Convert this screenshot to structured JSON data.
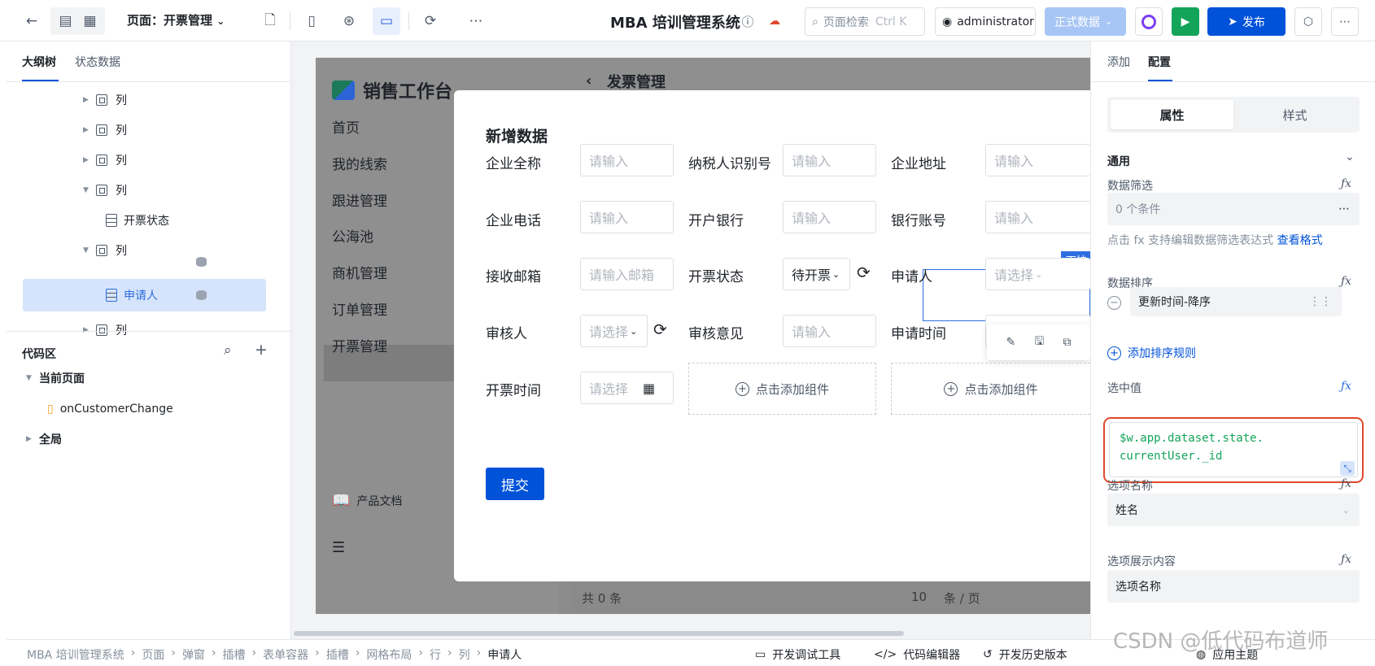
{
  "topbar": {
    "page_selector": "页面：开票管理",
    "app_title": "MBA 培训管理系统",
    "search_placeholder": "页面检索",
    "search_shortcut": "Ctrl K",
    "user": "administrator",
    "env": "正式数据",
    "publish": "发布"
  },
  "left": {
    "tabs": [
      "大纲树",
      "状态数据"
    ],
    "tree": [
      {
        "label": "列"
      },
      {
        "label": "列"
      },
      {
        "label": "列"
      },
      {
        "label": "列"
      },
      {
        "label": "开票状态"
      },
      {
        "label": "列"
      },
      {
        "label": "申请人"
      },
      {
        "label": "列"
      }
    ],
    "code_area": "代码区",
    "code_tree": [
      "当前页面",
      "onCustomerChange",
      "全局"
    ]
  },
  "stage": {
    "brand": "销售工作台",
    "header_title": "发票管理",
    "nav": [
      "首页",
      "我的线索",
      "跟进管理",
      "公海池",
      "商机管理",
      "订单管理",
      "开票管理"
    ],
    "doc_link": "产品文档",
    "footer_count": "共 0 条",
    "footer_page": "10",
    "footer_per": "条 / 页"
  },
  "modal": {
    "title": "新增数据",
    "fields": [
      {
        "label": "企业全称",
        "placeholder": "请输入"
      },
      {
        "label": "纳税人识别号",
        "placeholder": "请输入"
      },
      {
        "label": "企业地址",
        "placeholder": "请输入"
      },
      {
        "label": "企业电话",
        "placeholder": "请输入"
      },
      {
        "label": "开户银行",
        "placeholder": "请输入"
      },
      {
        "label": "银行账号",
        "placeholder": "请输入"
      },
      {
        "label": "接收邮箱",
        "placeholder": "请输入邮箱"
      },
      {
        "label": "开票状态",
        "value": "待开票"
      },
      {
        "label": "申请人",
        "placeholder": "请选择"
      },
      {
        "label": "审核人",
        "placeholder": "请选择"
      },
      {
        "label": "审核意见",
        "placeholder": "请输入"
      },
      {
        "label": "申请时间",
        "placeholder": ""
      },
      {
        "label": "开票时间",
        "placeholder": "请选择"
      }
    ],
    "add_component": "点击添加组件",
    "submit": "提交",
    "selection_tag": "下拉"
  },
  "right": {
    "tabs": [
      "添加",
      "配置"
    ],
    "segments": [
      "属性",
      "样式"
    ],
    "section_general": "通用",
    "data_filter_label": "数据筛选",
    "data_filter_value": "0 个条件",
    "hint_text": "点击 fx 支持编辑数据筛选表达式",
    "hint_link": "查看格式",
    "sort_label": "数据排序",
    "sort_value": "更新时间-降序",
    "add_sort": "添加排序规则",
    "selected_label": "选中值",
    "selected_code": "$w.app.dataset.state.\ncurrentUser._id",
    "option_name_label": "选项名称",
    "option_name_value": "姓名",
    "option_display_label": "选项展示内容",
    "option_display_value": "选项名称"
  },
  "statusbar": {
    "breadcrumb": [
      "MBA 培训管理系统",
      "页面",
      "弹窗",
      "插槽",
      "表单容器",
      "插槽",
      "网格布局",
      "行",
      "列",
      "申请人"
    ],
    "tools": [
      "开发调试工具",
      "代码编辑器",
      "开发历史版本",
      "应用主题"
    ]
  },
  "watermark": "CSDN @低代码布道师",
  "colors": {
    "primary": "#0052d9",
    "run": "#13a45a",
    "highlight": "#e0492d"
  }
}
